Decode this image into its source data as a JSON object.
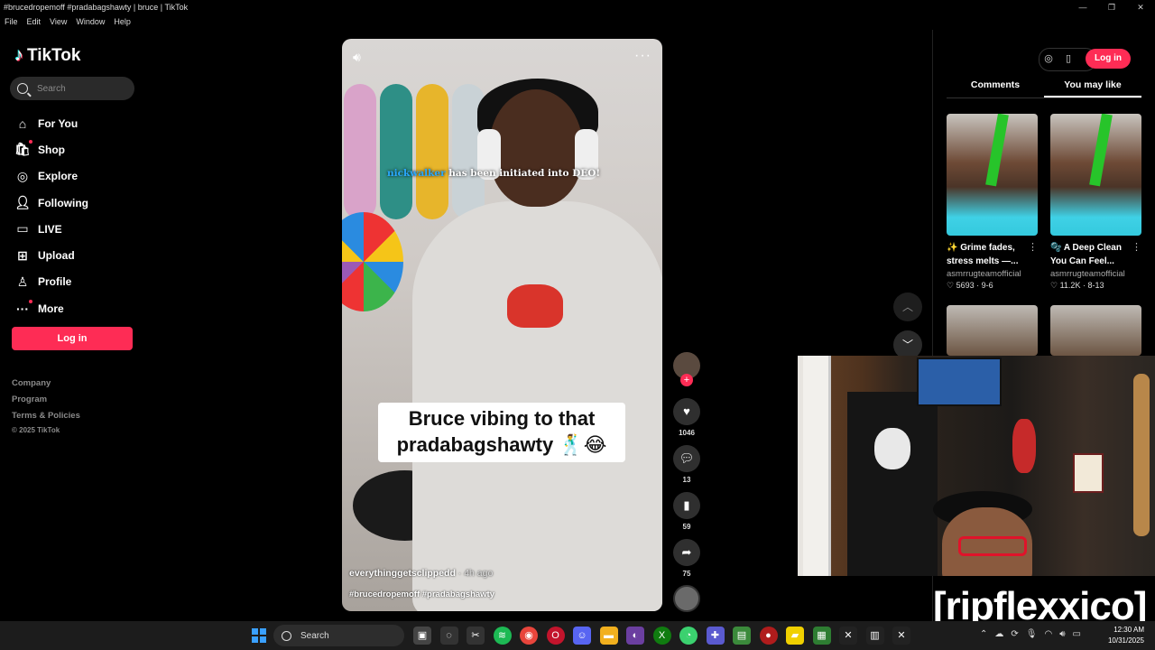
{
  "window": {
    "title": "#brucedropemoff #pradabagshawty | bruce | TikTok",
    "controls": [
      "—",
      "❐",
      "✕"
    ],
    "menu": [
      "File",
      "Edit",
      "View",
      "Window",
      "Help"
    ]
  },
  "sidebar": {
    "logo": "TikTok",
    "search_placeholder": "Search",
    "nav": [
      {
        "label": "For You",
        "icon": "home-icon"
      },
      {
        "label": "Shop",
        "icon": "shopping-bag-icon"
      },
      {
        "label": "Explore",
        "icon": "compass-icon"
      },
      {
        "label": "Following",
        "icon": "user-follow-icon"
      },
      {
        "label": "LIVE",
        "icon": "live-icon"
      },
      {
        "label": "Upload",
        "icon": "upload-icon"
      },
      {
        "label": "Profile",
        "icon": "profile-icon"
      },
      {
        "label": "More",
        "icon": "more-dots-icon"
      }
    ],
    "login_label": "Log in",
    "footer": [
      "Company",
      "Program",
      "Terms & Policies"
    ],
    "copyright": "© 2025 TikTok"
  },
  "video": {
    "overlay_name": "nickwalker",
    "overlay_text": "has been initiated into DEO!",
    "caption_line1": "Bruce vibing to that",
    "caption_line2": "pradabagshawty 🕺😂",
    "author": "everythinggetsclippedd",
    "time": "· 4h ago",
    "hashtags": "#brucedropemoff #pradabagshawty"
  },
  "actions": {
    "likes": "1046",
    "comments": "13",
    "saves": "59",
    "shares": "75"
  },
  "right_panel": {
    "login_label": "Log in",
    "tabs": [
      "Comments",
      "You may like"
    ],
    "active_tab": "You may like",
    "cards": [
      {
        "title_line1": "✨ Grime fades,",
        "title_line2": "stress melts —...",
        "user": "asmrrugteamofficial",
        "likes": "5693",
        "date": "9-6"
      },
      {
        "title_line1": "🫧 A Deep Clean",
        "title_line2": "You Can Feel...",
        "user": "asmrrugteamofficial",
        "likes": "11.2K",
        "date": "8-13"
      }
    ]
  },
  "webcam": {
    "streamer_tag": "[ripflexxico]"
  },
  "taskbar": {
    "search_label": "Search",
    "time": "12:30 AM",
    "date": "10/31/2025"
  },
  "colors": {
    "accent": "#fe2c55",
    "background": "#000000",
    "taskbar": "#1c1c1c"
  }
}
